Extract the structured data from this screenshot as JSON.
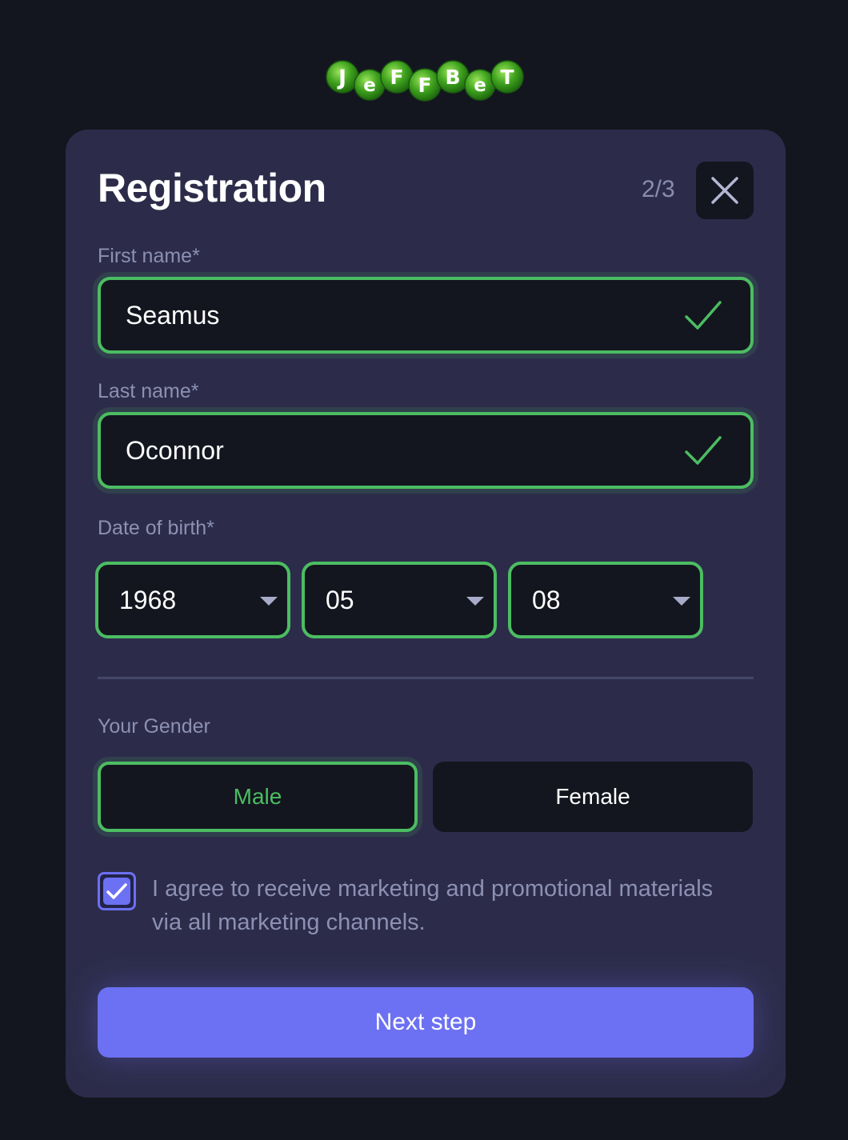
{
  "logo_text": "JeFFBeT",
  "form": {
    "title": "Registration",
    "step": "2/3",
    "first_name": {
      "label": "First name*",
      "value": "Seamus"
    },
    "last_name": {
      "label": "Last name*",
      "value": "Oconnor"
    },
    "dob": {
      "label": "Date of birth*",
      "year": "1968",
      "month": "05",
      "day": "08"
    },
    "gender": {
      "label": "Your Gender",
      "male": "Male",
      "female": "Female",
      "selected": "Male"
    },
    "consent": {
      "text": "I agree to receive marketing and promotional materials via all marketing channels.",
      "checked": true
    },
    "next_label": "Next step"
  },
  "colors": {
    "background": "#13161f",
    "card": "#2c2c4a",
    "valid_green": "#4cbd62",
    "accent": "#6c70f2",
    "muted_text": "#8d90b3"
  },
  "icons": [
    "close-icon",
    "check-icon",
    "chevron-down-icon",
    "checkbox-check-icon"
  ]
}
